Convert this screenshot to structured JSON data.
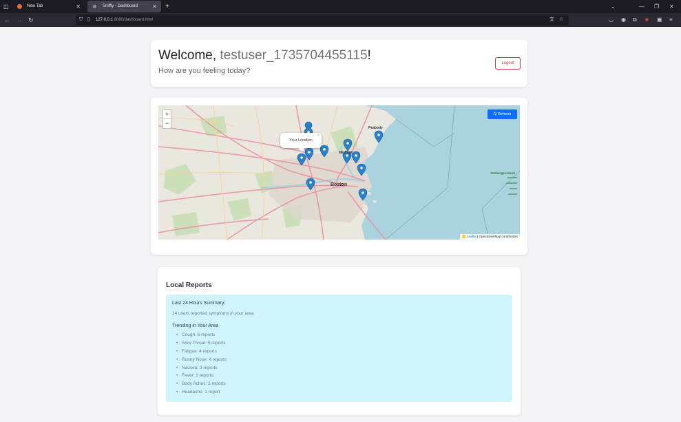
{
  "browser": {
    "tabs": [
      {
        "title": "New Tab",
        "active": false
      },
      {
        "title": "Sniffly - Dashboard",
        "active": true
      }
    ],
    "url_host": "127.0.0.1",
    "url_path": ":8080/dashboard.html",
    "new_tab_label": "+"
  },
  "welcome": {
    "greeting": "Welcome,",
    "username": "testuser_1735704455115",
    "suffix": "!",
    "subtitle": "How are you feeling today?",
    "logout_label": "Logout"
  },
  "map": {
    "zoom_in": "+",
    "zoom_out": "−",
    "refresh_label": "🗘 Refresh",
    "popup_text": "Your Location",
    "popup_close": "×",
    "attribution_leaflet": "🟨 Leaflet",
    "attribution_osm": "| OpenStreetMap contributors",
    "place_labels": [
      "Boston",
      "Medford",
      "Peabody",
      "Stellwagen Bank"
    ],
    "marker_count": 12,
    "colors": {
      "water": "#aad3df",
      "land": "#eae7df",
      "marker": "#2a81cb",
      "park": "#c8e0b4"
    }
  },
  "reports": {
    "title": "Local Reports",
    "summary_title": "Last 24 Hours Summary:",
    "summary_text": "14 users reported symptoms in your area",
    "trending_title": "Trending in Your Area",
    "trending": [
      "Cough: 6 reports",
      "Sore Throat: 5 reports",
      "Fatigue: 4 reports",
      "Runny Nose: 4 reports",
      "Nausea: 3 reports",
      "Fever: 3 reports",
      "Body Aches: 2 reports",
      "Headache: 1 report"
    ]
  }
}
